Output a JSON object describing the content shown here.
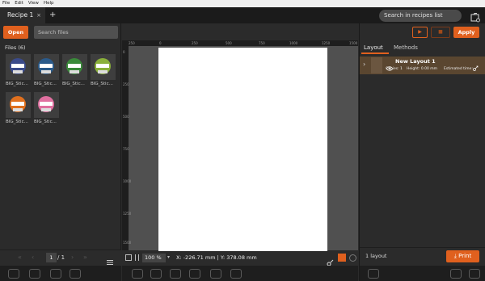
{
  "menu": [
    "File",
    "Edit",
    "View",
    "Help"
  ],
  "tab": {
    "title": "Recipe 1",
    "close": "×",
    "add": "+"
  },
  "recipe_search": {
    "placeholder": "Search in recipes list"
  },
  "left": {
    "open_label": "Open",
    "search_placeholder": "Search files",
    "files_title": "Files (6)",
    "files": [
      {
        "name": "BIG_Stic...",
        "color": "#3a4a8a"
      },
      {
        "name": "BIG_Stic...",
        "color": "#2a5a8a"
      },
      {
        "name": "BIG_Stic...",
        "color": "#3a8a3a"
      },
      {
        "name": "BIG_Stic...",
        "color": "#8ab03a"
      },
      {
        "name": "BIG_Stic...",
        "color": "#e0701e"
      },
      {
        "name": "BIG_Stic...",
        "color": "#e070a0"
      }
    ],
    "page": "1",
    "page_total": "/ 1"
  },
  "ruler_h": [
    "250",
    "0",
    "250",
    "500",
    "750",
    "1000",
    "1250",
    "1500"
  ],
  "ruler_v": [
    "0",
    "250",
    "500",
    "750",
    "1000",
    "1250",
    "1500"
  ],
  "center": {
    "zoom": "100 %",
    "coords": "X: -226.71 mm | Y: 378.08 mm"
  },
  "right": {
    "tabs": {
      "layout": "Layout",
      "methods": "Methods"
    },
    "apply_label": "Apply",
    "layout_name": "New Layout 1",
    "copies": "Copies: 1",
    "height": "Height: 0.00 mm",
    "estimated_time": "Estimated time: -",
    "layout_count": "1 layout",
    "print_label": "Print"
  },
  "colors": {
    "accent": "#e0601e"
  }
}
